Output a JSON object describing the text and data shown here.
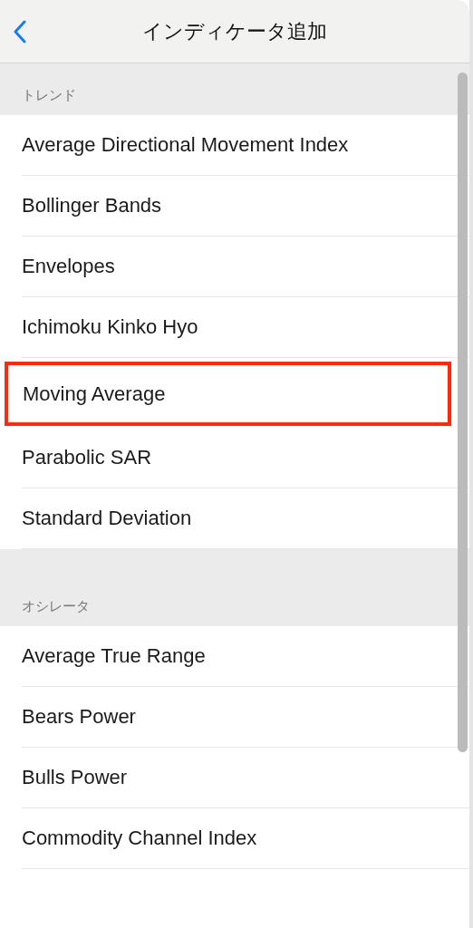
{
  "header": {
    "title": "インディケータ追加"
  },
  "sections": [
    {
      "title": "トレンド",
      "items": [
        {
          "label": "Average Directional Movement Index",
          "highlighted": false
        },
        {
          "label": "Bollinger Bands",
          "highlighted": false
        },
        {
          "label": "Envelopes",
          "highlighted": false
        },
        {
          "label": "Ichimoku Kinko Hyo",
          "highlighted": false
        },
        {
          "label": "Moving Average",
          "highlighted": true
        },
        {
          "label": "Parabolic SAR",
          "highlighted": false
        },
        {
          "label": "Standard Deviation",
          "highlighted": false
        }
      ]
    },
    {
      "title": "オシレータ",
      "items": [
        {
          "label": "Average True Range",
          "highlighted": false
        },
        {
          "label": "Bears Power",
          "highlighted": false
        },
        {
          "label": "Bulls Power",
          "highlighted": false
        },
        {
          "label": "Commodity Channel Index",
          "highlighted": false
        }
      ]
    }
  ]
}
